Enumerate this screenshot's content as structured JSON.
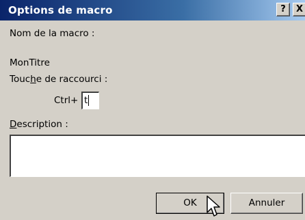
{
  "dialog": {
    "title": "Options de macro",
    "help_button": "?",
    "close_button": "X"
  },
  "fields": {
    "macro_name_label": "Nom de la macro :",
    "macro_name_value": "MonTitre",
    "shortcut_label_pre": "Touc",
    "shortcut_label_accel": "h",
    "shortcut_label_post": "e de raccourci :",
    "shortcut_prefix": "Ctrl+",
    "shortcut_value": "t",
    "description_label_accel": "D",
    "description_label_rest": "escription :",
    "description_value": ""
  },
  "buttons": {
    "ok_label": "OK",
    "cancel_label": "Annuler"
  },
  "icons": {
    "cursor": "arrow-pointer-icon"
  },
  "colors": {
    "titlebar_start": "#0a246a",
    "titlebar_end": "#a6caf0",
    "dialog_bg": "#d4d0c8"
  }
}
